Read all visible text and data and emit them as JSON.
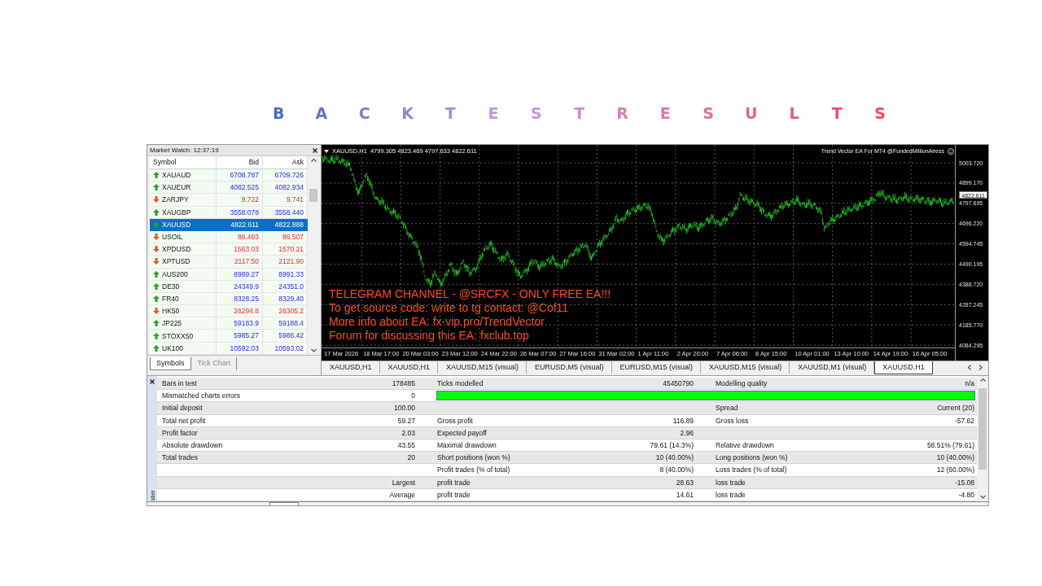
{
  "page_title": "B A C K T E S T R E S U L T S",
  "market_watch": {
    "title": "Market Watch: 12:37:19",
    "columns": [
      "Symbol",
      "Bid",
      "Ask"
    ],
    "rows": [
      {
        "symbol": "XAUAUD",
        "bid": "6708.787",
        "ask": "6709.726",
        "kind": "up",
        "selected": false
      },
      {
        "symbol": "XAUEUR",
        "bid": "4082.525",
        "ask": "4082.934",
        "kind": "up",
        "selected": false
      },
      {
        "symbol": "ZARJPY",
        "bid": "9.722",
        "ask": "9.741",
        "kind": "down",
        "selected": false
      },
      {
        "symbol": "XAUGBP",
        "bid": "3558.078",
        "ask": "3558.440",
        "kind": "up",
        "selected": false
      },
      {
        "symbol": "XAUUSD",
        "bid": "4822.611",
        "ask": "4822.888",
        "kind": "up",
        "selected": true
      },
      {
        "symbol": "USOIL",
        "bid": "86.493",
        "ask": "86.507",
        "kind": "down",
        "selected": false
      },
      {
        "symbol": "XPDUSD",
        "bid": "1563.03",
        "ask": "1570.21",
        "kind": "down",
        "selected": false
      },
      {
        "symbol": "XPTUSD",
        "bid": "2117.50",
        "ask": "2121.90",
        "kind": "down",
        "selected": false
      },
      {
        "symbol": "AUS200",
        "bid": "8989.27",
        "ask": "8991.33",
        "kind": "up",
        "selected": false
      },
      {
        "symbol": "DE30",
        "bid": "24349.9",
        "ask": "24351.0",
        "kind": "up",
        "selected": false
      },
      {
        "symbol": "FR40",
        "bid": "8328.25",
        "ask": "8329.40",
        "kind": "up",
        "selected": false
      },
      {
        "symbol": "HK50",
        "bid": "26294.8",
        "ask": "26305.2",
        "kind": "down",
        "selected": false
      },
      {
        "symbol": "JP225",
        "bid": "59183.9",
        "ask": "59188.4",
        "kind": "up",
        "selected": false
      },
      {
        "symbol": "STOXX50",
        "bid": "5985.27",
        "ask": "5986.42",
        "kind": "up",
        "selected": false
      },
      {
        "symbol": "UK100",
        "bid": "10592.03",
        "ask": "10593.02",
        "kind": "up",
        "selected": false
      }
    ],
    "tabs": [
      {
        "label": "Symbols",
        "selected": true
      },
      {
        "label": "Tick Chart",
        "selected": false
      }
    ]
  },
  "chart": {
    "symbol": "XAUUSD,H1",
    "ohlc": "4799.305 4823.469 4797.633 4822.611",
    "expert": "Trend Vector EA For MT4 @FundedMillionAiress",
    "price_labels": [
      "5003.720",
      "4899.170",
      "4797.695",
      "4696.220",
      "4594.745",
      "4490.195",
      "4388.720",
      "4287.245",
      "4185.770",
      "4084.295"
    ],
    "current_price": "4822.611",
    "time_labels": [
      "17 Mar 2026",
      "18 Mar 17:00",
      "20 Mar 03:00",
      "23 Mar 12:00",
      "24 Mar 22:00",
      "26 Mar 07:00",
      "27 Mar 16:00",
      "31 Mar 02:00",
      "1 Apr 11:00",
      "2 Apr 20:00",
      "7 Apr 06:00",
      "8 Apr 15:00",
      "10 Apr 01:00",
      "13 Apr 10:00",
      "14 Apr 19:00",
      "16 Apr 05:00"
    ],
    "comment_lines": [
      "TELEGRAM CHANNEL - @SRCFX - ONLY FREE EA!!!",
      "To get source code: write to tg contact: @Cof11",
      "More info about EA: fx-vip.pro/TrendVector",
      "Forum for discussing this EA: fxclub.top"
    ]
  },
  "chart_tabs": [
    {
      "label": "XAUUSD,H1",
      "selected": false
    },
    {
      "label": "XAUUSD,H1",
      "selected": false
    },
    {
      "label": "XAUUSD,M15 (visual)",
      "selected": false
    },
    {
      "label": "EURUSD,M5 (visual)",
      "selected": false
    },
    {
      "label": "EURUSD,M15 (visual)",
      "selected": false
    },
    {
      "label": "XAUUSD,M15 (visual)",
      "selected": false
    },
    {
      "label": "XAUUSD,M1 (visual)",
      "selected": false
    },
    {
      "label": "XAUUSD,H1",
      "selected": true
    }
  ],
  "results": {
    "side_label": "ster",
    "rows": [
      {
        "kind": "text",
        "column_1": "Bars in test",
        "column_2": "178485",
        "column_3": "Ticks modelled",
        "column_4": "45450790",
        "column_5": "Modelling quality",
        "column_6": "n/a"
      },
      {
        "kind": "bar",
        "column_1": "Mismatched charts errors",
        "column_2": "0"
      },
      {
        "kind": "text",
        "column_1": "Initial deposit",
        "column_2": "100.00",
        "column_5": "Spread",
        "column_6": "Current (20)"
      },
      {
        "kind": "text",
        "column_1": "Total net profit",
        "column_2": "59.27",
        "column_3": "Gross profit",
        "column_4": "116.89",
        "column_5": "Gross loss",
        "column_6": "-57.62"
      },
      {
        "kind": "text",
        "column_1": "Profit factor",
        "column_2": "2.03",
        "column_3": "Expected payoff",
        "column_4": "2.96"
      },
      {
        "kind": "text",
        "column_1": "Absolute drawdown",
        "column_2": "43.55",
        "column_3": "Maximal drawdown",
        "column_4": "79.61 (14.3%)",
        "column_5": "Relative drawdown",
        "column_6": "58.51% (79.61)"
      },
      {
        "kind": "text",
        "column_1": "Total trades",
        "column_2": "20",
        "column_3": "Short positions (won %)",
        "column_4": "10 (40.00%)",
        "column_5": "Long positions (won %)",
        "column_6": "10 (40.00%)"
      },
      {
        "kind": "text",
        "column_3": "Profit trades (% of total)",
        "column_4": "8 (40.00%)",
        "column_5": "Loss trades (% of total)",
        "column_6": "12 (60.00%)"
      },
      {
        "kind": "text",
        "column_2": "Largest",
        "column_3": "profit trade",
        "column_4": "28.63",
        "column_5": "loss trade",
        "column_6": "-15.08"
      },
      {
        "kind": "text",
        "column_2": "Average",
        "column_3": "profit trade",
        "column_4": "14.61",
        "column_5": "loss trade",
        "column_6": "-4.80"
      }
    ]
  }
}
